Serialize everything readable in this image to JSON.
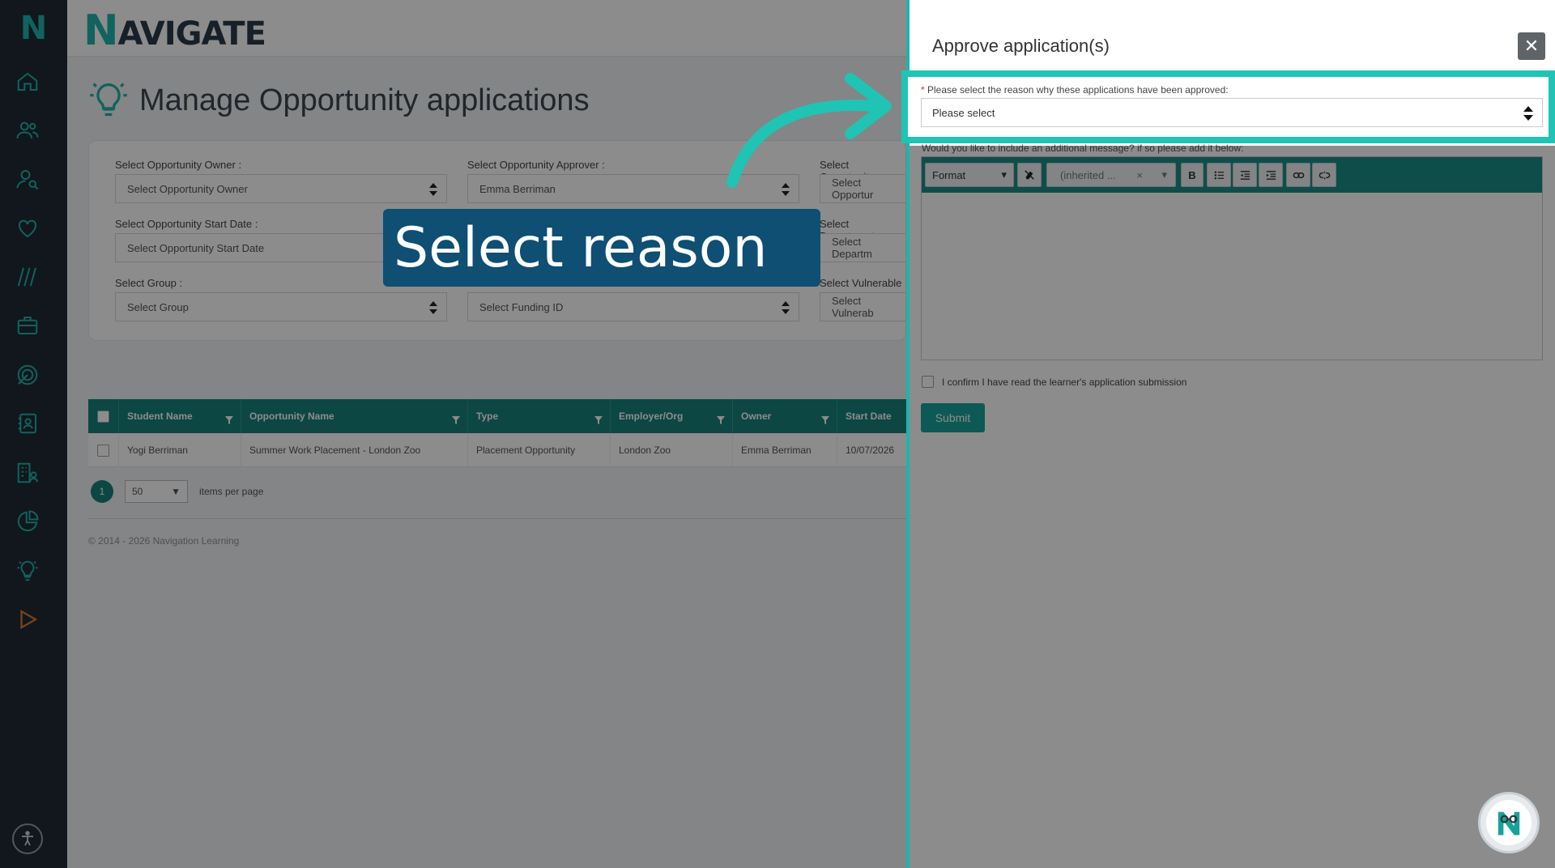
{
  "brand": {
    "rail_letter": "N",
    "logo_first": "N",
    "logo_rest": "AVIGATE"
  },
  "page": {
    "title": "Manage Opportunity applications"
  },
  "filters": {
    "owner": {
      "label": "Select Opportunity Owner :",
      "value": "Select Opportunity Owner"
    },
    "approver": {
      "label": "Select Opportunity Approver :",
      "value": "Emma Berriman"
    },
    "type": {
      "label": "Select Opportunity",
      "value": "Select Opportur"
    },
    "start_date": {
      "label": "Select Opportunity Start Date :",
      "value": "Select Opportunity Start Date"
    },
    "department": {
      "label": "Select Department",
      "value": "Select Departm"
    },
    "group": {
      "label": "Select Group :",
      "value": "Select Group"
    },
    "funding": {
      "value": "Select Funding ID"
    },
    "vulnerable": {
      "label": "Select Vulnerable",
      "value": "Select Vulnerab"
    }
  },
  "table": {
    "headers": [
      "Student Name",
      "Opportunity Name",
      "Type",
      "Employer/Org",
      "Owner",
      "Start Date"
    ],
    "rows": [
      [
        "Yogi Berriman",
        "Summer Work Placement - London Zoo",
        "Placement Opportunity",
        "London Zoo",
        "Emma Berriman",
        "10/07/2026"
      ]
    ]
  },
  "pager": {
    "page": "1",
    "per_page": "50",
    "per_page_label": "items per page"
  },
  "footer": {
    "copyright": "© 2014 - 2026 Navigation Learning"
  },
  "callout": {
    "text": "Select reason"
  },
  "drawer": {
    "title": "Approve application(s)",
    "close": "✕",
    "reason_label": "Please select the reason why these applications have been approved:",
    "reason_required": "*",
    "reason_value": "Please select",
    "message_label": "Would you like to include an additional message? if so please add it below:",
    "toolbar": {
      "format": "Format",
      "font": "(inherited ...",
      "clear": "×",
      "bold": "B"
    },
    "confirm_label": "I confirm I have read the learner's application submission",
    "submit": "Submit"
  },
  "colors": {
    "teal": "#1fb3ac",
    "teal_dark": "#16827c",
    "callout": "#0e4f73",
    "rail": "#1f2a36"
  }
}
